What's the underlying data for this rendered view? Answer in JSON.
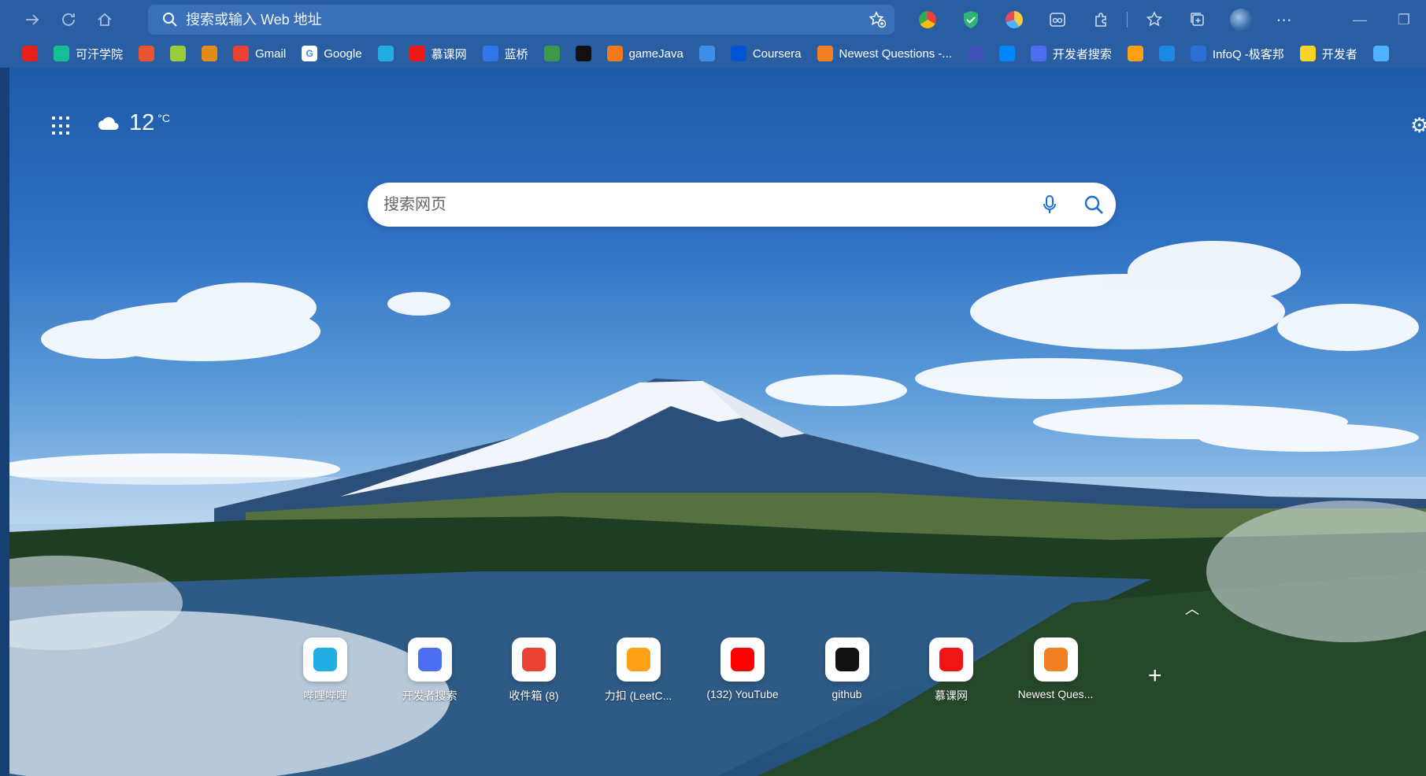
{
  "browser": {
    "address_placeholder": "搜索或输入 Web 地址"
  },
  "bookmarks": [
    {
      "label": "",
      "icon": "youtube-icon",
      "color": "#e62117"
    },
    {
      "label": "可汗学院",
      "icon": "khan-academy-icon",
      "color": "#14bf96"
    },
    {
      "label": "",
      "icon": "csdn-icon",
      "color": "#e9532f"
    },
    {
      "label": "",
      "icon": "app-icon",
      "color": "#9ccc3d"
    },
    {
      "label": "",
      "icon": "lion-icon",
      "color": "#e38b1b"
    },
    {
      "label": "Gmail",
      "icon": "gmail-icon",
      "color": "#ea4335"
    },
    {
      "label": "Google",
      "icon": "google-icon",
      "color": "#ffffff"
    },
    {
      "label": "",
      "icon": "bilibili-icon",
      "color": "#23ade5"
    },
    {
      "label": "慕课网",
      "icon": "imooc-icon",
      "color": "#f01414"
    },
    {
      "label": "蓝桥",
      "icon": "lanqiao-icon",
      "color": "#2f78e9"
    },
    {
      "label": "",
      "icon": "flag-icon",
      "color": "#3a9a4a"
    },
    {
      "label": "",
      "icon": "github-icon",
      "color": "#111111"
    },
    {
      "label": "gameJava",
      "icon": "gamejava-icon",
      "color": "#f07a1a"
    },
    {
      "label": "",
      "icon": "layers-icon",
      "color": "#3d8ee8"
    },
    {
      "label": "Coursera",
      "icon": "coursera-icon",
      "color": "#0056d2"
    },
    {
      "label": "Newest Questions -...",
      "icon": "stackoverflow-icon",
      "color": "#f48024"
    },
    {
      "label": "",
      "icon": "shield-icon",
      "color": "#3f51b5"
    },
    {
      "label": "",
      "icon": "zhihu-icon",
      "color": "#0084ff"
    },
    {
      "label": "开发者搜索",
      "icon": "baidu-dev-icon",
      "color": "#4e6ef2"
    },
    {
      "label": "",
      "icon": "leetcode-icon",
      "color": "#ffa116"
    },
    {
      "label": "",
      "icon": "check-icon",
      "color": "#1e88e5"
    },
    {
      "label": "InfoQ -极客邦",
      "icon": "infoq-icon",
      "color": "#2b6ed8"
    },
    {
      "label": "开发者",
      "icon": "dev-icon",
      "color": "#f9d423"
    },
    {
      "label": "",
      "icon": "infinity-icon",
      "color": "#4fb3ff"
    }
  ],
  "weather": {
    "temp": "12",
    "unit": "°C",
    "icon": "cloud-icon"
  },
  "search": {
    "placeholder": "搜索网页"
  },
  "quick_links": [
    {
      "label": "哔哩哔哩",
      "icon": "bilibili-icon",
      "color": "#23ade5"
    },
    {
      "label": "开发者搜索",
      "icon": "baidu-dev-icon",
      "color": "#4e6ef2"
    },
    {
      "label": "收件箱 (8)",
      "icon": "gmail-icon",
      "color": "#ea4335"
    },
    {
      "label": "力扣 (LeetC...",
      "icon": "leetcode-icon",
      "color": "#ffa116"
    },
    {
      "label": "(132) YouTube",
      "icon": "youtube-icon",
      "color": "#ff0000"
    },
    {
      "label": "github",
      "icon": "github-icon",
      "color": "#111111"
    },
    {
      "label": "慕课网",
      "icon": "imooc-icon",
      "color": "#f01414"
    },
    {
      "label": "Newest Ques...",
      "icon": "stackoverflow-icon",
      "color": "#f48024"
    }
  ]
}
